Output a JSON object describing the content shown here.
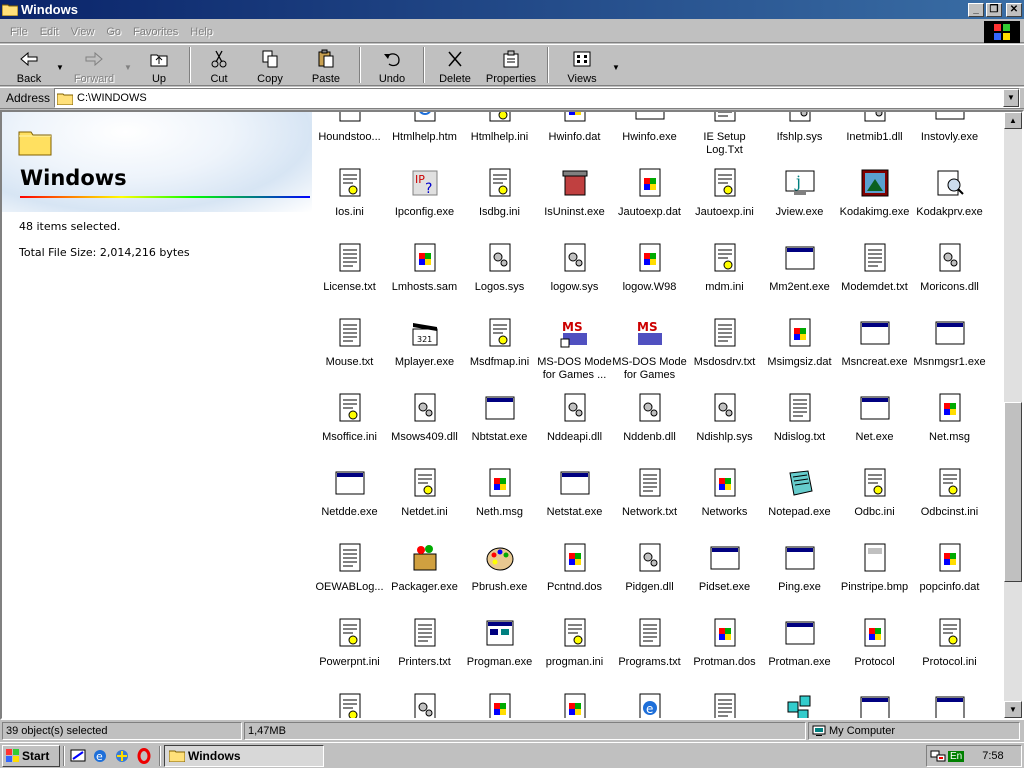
{
  "window": {
    "title": "Windows"
  },
  "menu": [
    "File",
    "Edit",
    "View",
    "Go",
    "Favorites",
    "Help"
  ],
  "toolbar": {
    "back": "Back",
    "forward": "Forward",
    "up": "Up",
    "cut": "Cut",
    "copy": "Copy",
    "paste": "Paste",
    "undo": "Undo",
    "delete": "Delete",
    "properties": "Properties",
    "views": "Views"
  },
  "address": {
    "label": "Address",
    "value": "C:\\WINDOWS"
  },
  "left_pane": {
    "folder_title": "Windows",
    "selected_count": "48 items selected.",
    "total_size": "Total File Size: 2,014,216 bytes"
  },
  "files": [
    {
      "name": "Houndstoo...",
      "icon": "bitmap-icon"
    },
    {
      "name": "Htmlhelp.htm",
      "icon": "html-icon"
    },
    {
      "name": "Htmlhelp.ini",
      "icon": "ini-icon"
    },
    {
      "name": "Hwinfo.dat",
      "icon": "dat-icon"
    },
    {
      "name": "Hwinfo.exe",
      "icon": "exe-icon"
    },
    {
      "name": "IE Setup Log.Txt",
      "icon": "text-icon"
    },
    {
      "name": "Ifshlp.sys",
      "icon": "sys-icon"
    },
    {
      "name": "Inetmib1.dll",
      "icon": "dll-icon"
    },
    {
      "name": "Instovly.exe",
      "icon": "exe-icon"
    },
    {
      "name": "Ios.ini",
      "icon": "ini-icon"
    },
    {
      "name": "Ipconfig.exe",
      "icon": "ipconfig-icon"
    },
    {
      "name": "Isdbg.ini",
      "icon": "ini-icon"
    },
    {
      "name": "IsUninst.exe",
      "icon": "uninstall-icon"
    },
    {
      "name": "Jautoexp.dat",
      "icon": "dat-icon"
    },
    {
      "name": "Jautoexp.ini",
      "icon": "ini-icon"
    },
    {
      "name": "Jview.exe",
      "icon": "jview-icon"
    },
    {
      "name": "Kodakimg.exe",
      "icon": "kodak-icon"
    },
    {
      "name": "Kodakprv.exe",
      "icon": "kodak-preview-icon"
    },
    {
      "name": "License.txt",
      "icon": "text-icon"
    },
    {
      "name": "Lmhosts.sam",
      "icon": "unknown-file-icon"
    },
    {
      "name": "Logos.sys",
      "icon": "sys-icon"
    },
    {
      "name": "logow.sys",
      "icon": "sys-icon"
    },
    {
      "name": "logow.W98",
      "icon": "unknown-file-icon"
    },
    {
      "name": "mdm.ini",
      "icon": "ini-icon"
    },
    {
      "name": "Mm2ent.exe",
      "icon": "exe-icon"
    },
    {
      "name": "Modemdet.txt",
      "icon": "text-icon"
    },
    {
      "name": "Moricons.dll",
      "icon": "dll-icon"
    },
    {
      "name": "Mouse.txt",
      "icon": "text-icon"
    },
    {
      "name": "Mplayer.exe",
      "icon": "media-player-icon"
    },
    {
      "name": "Msdfmap.ini",
      "icon": "ini-icon"
    },
    {
      "name": "MS-DOS Mode for Games ...",
      "icon": "msdos-shortcut-icon"
    },
    {
      "name": "MS-DOS Mode for Games",
      "icon": "msdos-icon"
    },
    {
      "name": "Msdosdrv.txt",
      "icon": "text-icon"
    },
    {
      "name": "Msimgsiz.dat",
      "icon": "dat-icon"
    },
    {
      "name": "Msncreat.exe",
      "icon": "exe-icon"
    },
    {
      "name": "Msnmgsr1.exe",
      "icon": "exe-icon"
    },
    {
      "name": "Msoffice.ini",
      "icon": "ini-icon"
    },
    {
      "name": "Msows409.dll",
      "icon": "dll-icon"
    },
    {
      "name": "Nbtstat.exe",
      "icon": "exe-icon"
    },
    {
      "name": "Nddeapi.dll",
      "icon": "dll-icon"
    },
    {
      "name": "Nddenb.dll",
      "icon": "dll-icon"
    },
    {
      "name": "Ndishlp.sys",
      "icon": "sys-icon"
    },
    {
      "name": "Ndislog.txt",
      "icon": "text-icon"
    },
    {
      "name": "Net.exe",
      "icon": "exe-icon"
    },
    {
      "name": "Net.msg",
      "icon": "unknown-file-icon"
    },
    {
      "name": "Netdde.exe",
      "icon": "exe-icon"
    },
    {
      "name": "Netdet.ini",
      "icon": "ini-icon"
    },
    {
      "name": "Neth.msg",
      "icon": "unknown-file-icon"
    },
    {
      "name": "Netstat.exe",
      "icon": "exe-icon"
    },
    {
      "name": "Network.txt",
      "icon": "text-icon"
    },
    {
      "name": "Networks",
      "icon": "unknown-file-icon"
    },
    {
      "name": "Notepad.exe",
      "icon": "notepad-icon"
    },
    {
      "name": "Odbc.ini",
      "icon": "ini-icon"
    },
    {
      "name": "Odbcinst.ini",
      "icon": "ini-icon"
    },
    {
      "name": "OEWABLog...",
      "icon": "text-icon"
    },
    {
      "name": "Packager.exe",
      "icon": "packager-icon"
    },
    {
      "name": "Pbrush.exe",
      "icon": "paint-icon"
    },
    {
      "name": "Pcntnd.dos",
      "icon": "unknown-file-icon"
    },
    {
      "name": "Pidgen.dll",
      "icon": "dll-icon"
    },
    {
      "name": "Pidset.exe",
      "icon": "exe-icon"
    },
    {
      "name": "Ping.exe",
      "icon": "exe-icon"
    },
    {
      "name": "Pinstripe.bmp",
      "icon": "bitmap-icon"
    },
    {
      "name": "popcinfo.dat",
      "icon": "dat-icon"
    },
    {
      "name": "Powerpnt.ini",
      "icon": "ini-icon"
    },
    {
      "name": "Printers.txt",
      "icon": "text-icon"
    },
    {
      "name": "Progman.exe",
      "icon": "progman-icon"
    },
    {
      "name": "progman.ini",
      "icon": "ini-icon"
    },
    {
      "name": "Programs.txt",
      "icon": "text-icon"
    },
    {
      "name": "Protman.dos",
      "icon": "unknown-file-icon"
    },
    {
      "name": "Protman.exe",
      "icon": "exe-icon"
    },
    {
      "name": "Protocol",
      "icon": "unknown-file-icon"
    },
    {
      "name": "Protocol.ini",
      "icon": "ini-icon"
    },
    {
      "name": "",
      "icon": "ini-icon"
    },
    {
      "name": "",
      "icon": "dll-icon"
    },
    {
      "name": "",
      "icon": "unknown-file-icon"
    },
    {
      "name": "",
      "icon": "unknown-file-icon"
    },
    {
      "name": "",
      "icon": "html-icon"
    },
    {
      "name": "",
      "icon": "text-icon"
    },
    {
      "name": "",
      "icon": "network-icon"
    },
    {
      "name": "",
      "icon": "exe-icon"
    },
    {
      "name": "",
      "icon": "exe-icon"
    }
  ],
  "status": {
    "selected": "39 object(s) selected",
    "size": "1,47MB",
    "zone": "My Computer"
  },
  "taskbar": {
    "start": "Start",
    "task": "Windows",
    "lang": "En",
    "clock": "7:58"
  },
  "colors": {
    "titlebar": "#0a246a",
    "face": "#c0c0c0",
    "tray_lang": "#008000"
  }
}
